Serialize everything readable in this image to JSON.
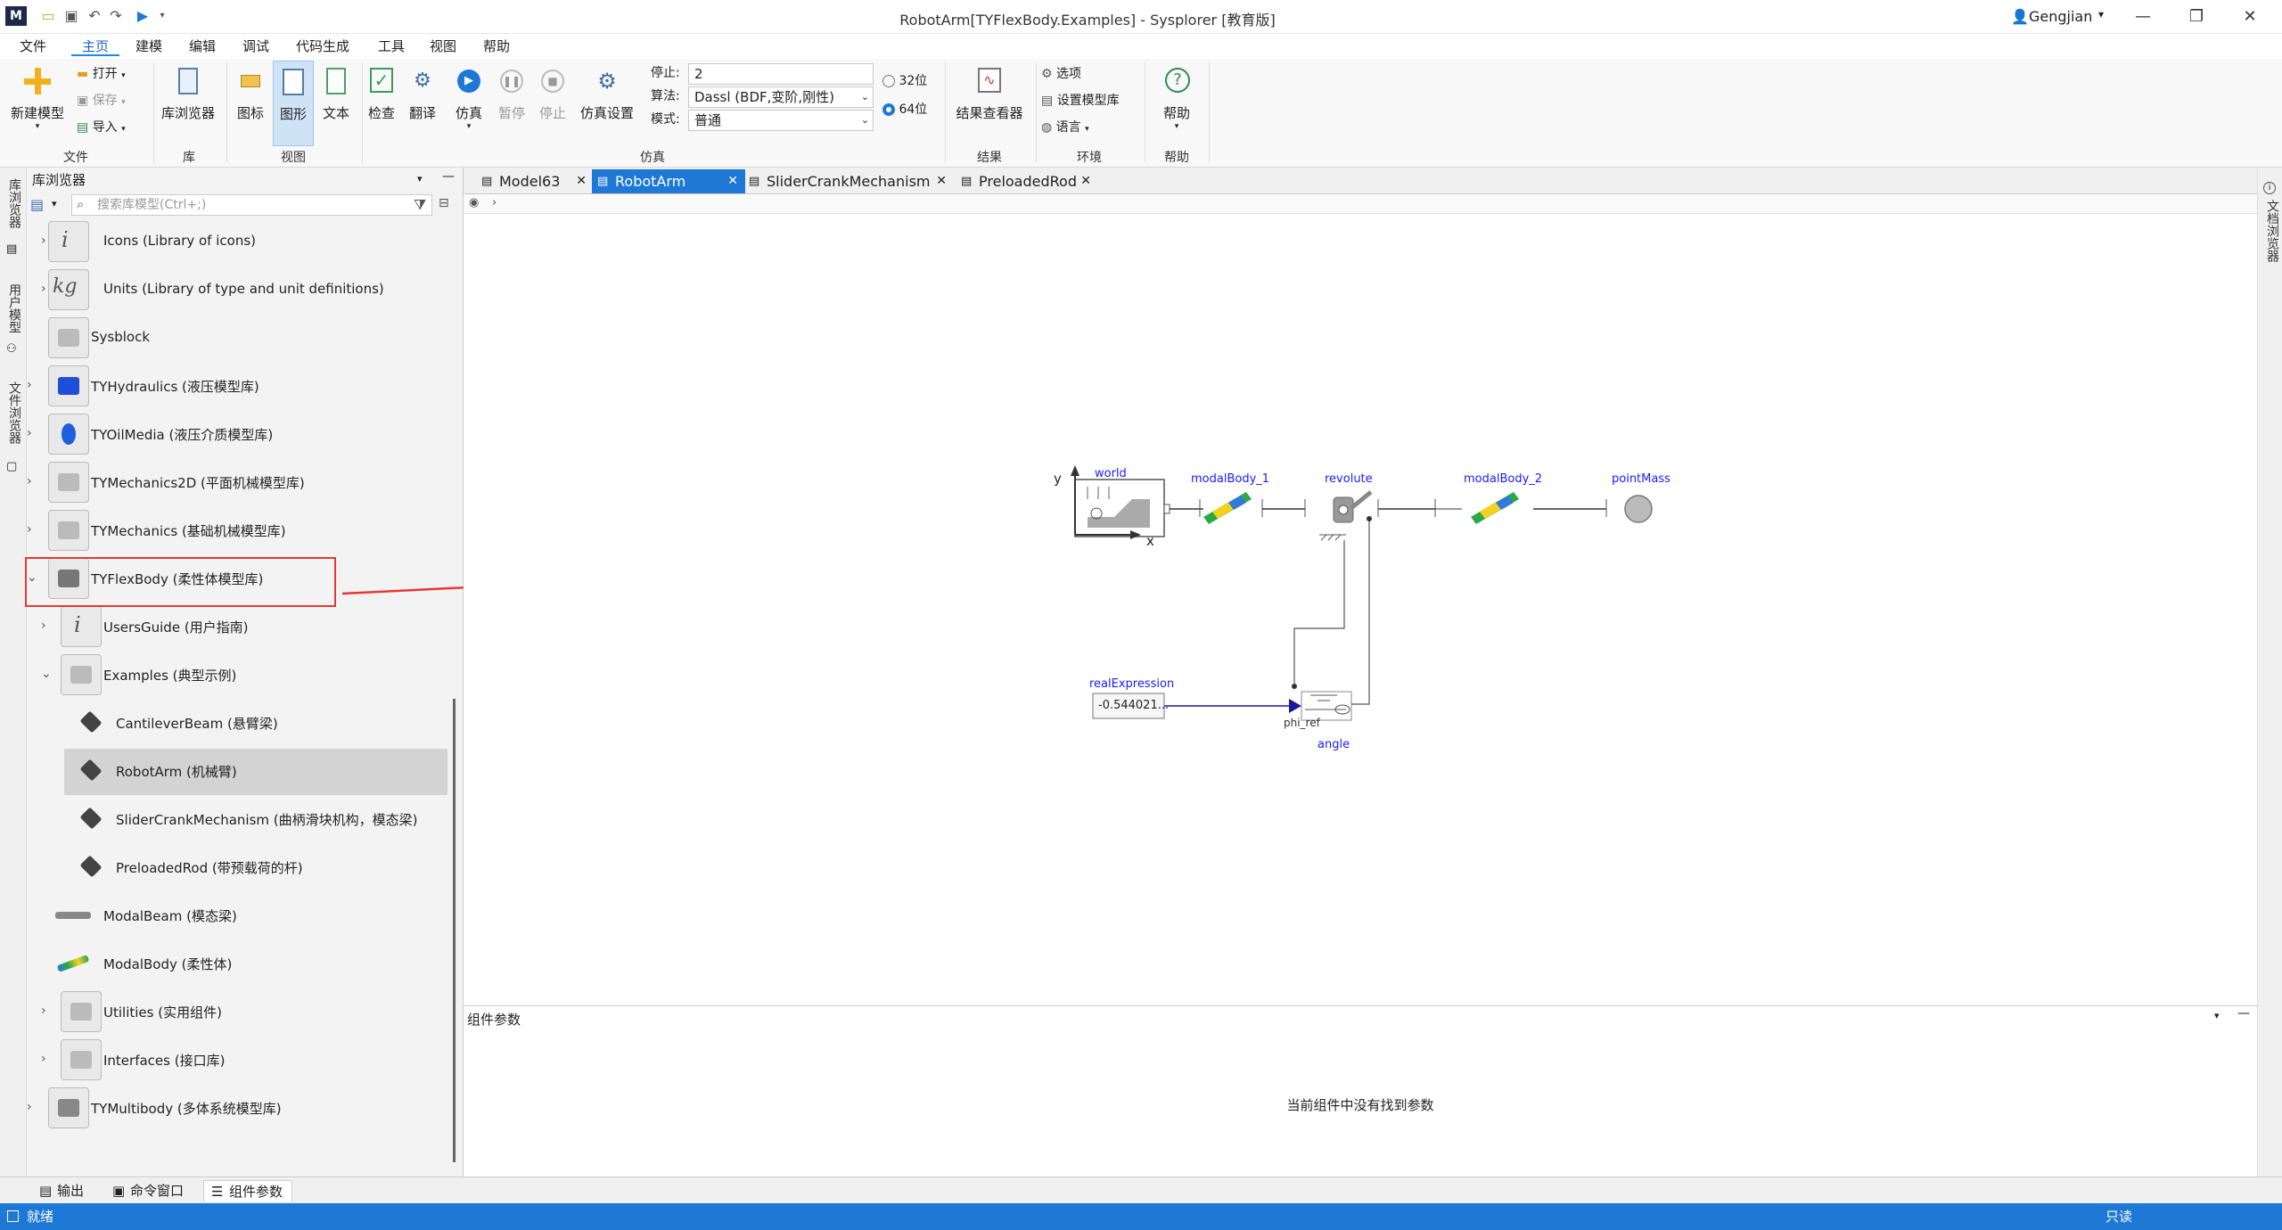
{
  "window": {
    "title": "RobotArm[TYFlexBody.Examples] - Sysplorer [教育版]",
    "user": "Gengjian"
  },
  "menu": [
    "文件",
    "主页",
    "建模",
    "编辑",
    "调试",
    "代码生成",
    "工具",
    "视图",
    "帮助"
  ],
  "search_placeholder": "搜索",
  "ribbon": {
    "new_model": "新建模型",
    "open": "打开",
    "save": "保存",
    "import": "导入",
    "lib_browser": "库浏览器",
    "icon": "图标",
    "diagram": "图形",
    "text": "文本",
    "check": "检查",
    "translate": "翻译",
    "simulate": "仿真",
    "pause": "暂停",
    "stop": "停止",
    "sim_settings": "仿真设置",
    "stop_label": "停止:",
    "stop_value": "2",
    "algo_label": "算法:",
    "algo_value": "Dassl (BDF,变阶,刚性)",
    "mode_label": "模式:",
    "mode_value": "普通",
    "bit32": "32位",
    "bit64": "64位",
    "result_viewer": "结果查看器",
    "options": "选项",
    "set_lib": "设置模型库",
    "language": "语言",
    "help": "帮助",
    "groups": {
      "file": "文件",
      "lib": "库",
      "view": "视图",
      "sim": "仿真",
      "result": "结果",
      "env": "环境",
      "help": "帮助"
    }
  },
  "left_tabs": [
    "库浏览器",
    "用户模型",
    "文件浏览器"
  ],
  "right_tabs": [
    "文档浏览器"
  ],
  "library": {
    "title": "库浏览器",
    "search_placeholder": "搜索库模型(Ctrl+;)",
    "items": [
      {
        "label": "Icons (Library of icons)",
        "icon": "info-icon"
      },
      {
        "label": "Units (Library of type and unit definitions)",
        "icon": "kg-icon"
      },
      {
        "label": "Sysblock",
        "icon": "block-icon"
      },
      {
        "label": "TYHydraulics (液压模型库)",
        "icon": "hydraulic-icon"
      },
      {
        "label": "TYOilMedia (液压介质模型库)",
        "icon": "oil-drop-icon"
      },
      {
        "label": "TYMechanics2D (平面机械模型库)",
        "icon": "mech2d-icon"
      },
      {
        "label": "TYMechanics (基础机械模型库)",
        "icon": "mech-icon"
      },
      {
        "label": "TYFlexBody (柔性体模型库)",
        "icon": "flexbody-icon"
      },
      {
        "label": "UsersGuide (用户指南)",
        "icon": "info-icon"
      },
      {
        "label": "Examples (典型示例)",
        "icon": "cube-icon"
      },
      {
        "label": "CantileverBeam (悬臂梁)",
        "icon": "layers-icon"
      },
      {
        "label": "RobotArm (机械臂)",
        "icon": "layers-icon"
      },
      {
        "label": "SliderCrankMechanism (曲柄滑块机构，模态梁)",
        "icon": "layers-icon"
      },
      {
        "label": "PreloadedRod (带预载荷的杆)",
        "icon": "layers-icon"
      },
      {
        "label": "ModalBeam (模态梁)",
        "icon": "beam-icon"
      },
      {
        "label": "ModalBody (柔性体)",
        "icon": "modal-body-icon"
      },
      {
        "label": "Utilities (实用组件)",
        "icon": "tools-icon"
      },
      {
        "label": "Interfaces (接口库)",
        "icon": "interface-icon"
      },
      {
        "label": "TYMultibody (多体系统模型库)",
        "icon": "multibody-icon"
      }
    ]
  },
  "tabs": [
    {
      "label": "Model63"
    },
    {
      "label": "RobotArm"
    },
    {
      "label": "SliderCrankMechanism"
    },
    {
      "label": "PreloadedRod"
    }
  ],
  "diagram": {
    "world": "world",
    "axis_y": "y",
    "axis_x": "x",
    "modalBody_1": "modalBody_1",
    "revolute": "revolute",
    "modalBody_2": "modalBody_2",
    "pointMass": "pointMass",
    "realExpression": "realExpression",
    "realExpression_value": "-0.544021...",
    "phi_ref": "phi_ref",
    "angle": "angle"
  },
  "params": {
    "title": "组件参数",
    "empty": "当前组件中没有找到参数"
  },
  "bottom_tabs": [
    "输出",
    "命令窗口",
    "组件参数"
  ],
  "status": {
    "left": "就绪",
    "right": "只读"
  },
  "colors": {
    "accent": "#1e78d6",
    "highlight": "#e53935",
    "link_blue": "#1a1aff"
  }
}
